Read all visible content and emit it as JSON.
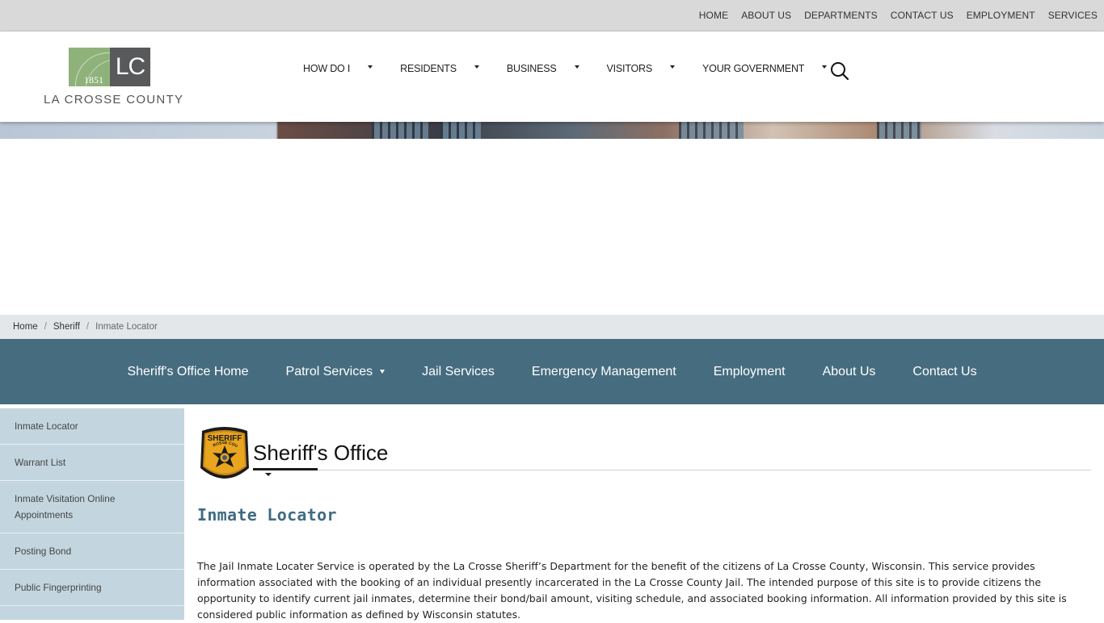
{
  "topbar": {
    "links": [
      "HOME",
      "ABOUT US",
      "DEPARTMENTS",
      "CONTACT US",
      "EMPLOYMENT",
      "SERVICES"
    ]
  },
  "logo": {
    "monogram": "LC",
    "year": "1851",
    "name": "LA CROSSE COUNTY",
    "colors": {
      "green": "#8fb27a",
      "gray": "#58595b"
    }
  },
  "mainnav": {
    "items": [
      "HOW DO I",
      "RESIDENTS",
      "BUSINESS",
      "VISITORS",
      "YOUR GOVERNMENT"
    ],
    "search_icon": "search-icon"
  },
  "breadcrumb": {
    "items": [
      "Home",
      "Sheriff"
    ],
    "current": "Inmate Locator"
  },
  "deptnav": {
    "background": "#466c7f",
    "items": [
      "Sheriff's Office Home",
      "Patrol Services",
      "Jail Services",
      "Emergency Management",
      "Employment",
      "About Us",
      "Contact Us"
    ]
  },
  "sidebar": {
    "background": "#c3d6df",
    "items": [
      "Inmate Locator",
      "Warrant List",
      "Inmate Visitation Online Appointments",
      "Posting Bond",
      "Public Fingerprinting"
    ]
  },
  "content": {
    "badge_icon": "sheriff-star-badge-icon",
    "badge_text_top": "SHERIFF",
    "badge_text_arc": "LA CROSSE COUNTY",
    "office_title": "Sheriff's Office",
    "heading": "Inmate Locator",
    "heading_color": "#3f6b84",
    "intro": "The Jail Inmate Locater Service is operated by the La Crosse Sheriff’s Department for the benefit of the citizens of La Crosse County, Wisconsin. This service provides information associated with the booking of an individual presently incarcerated in the La Crosse County Jail. The intended purpose of this site is to provide citizens the opportunity to identify current jail inmates, determine their bond/bail amount, visiting schedule, and associated booking information. All information provided by this site is considered public information as defined by Wisconsin statutes."
  }
}
